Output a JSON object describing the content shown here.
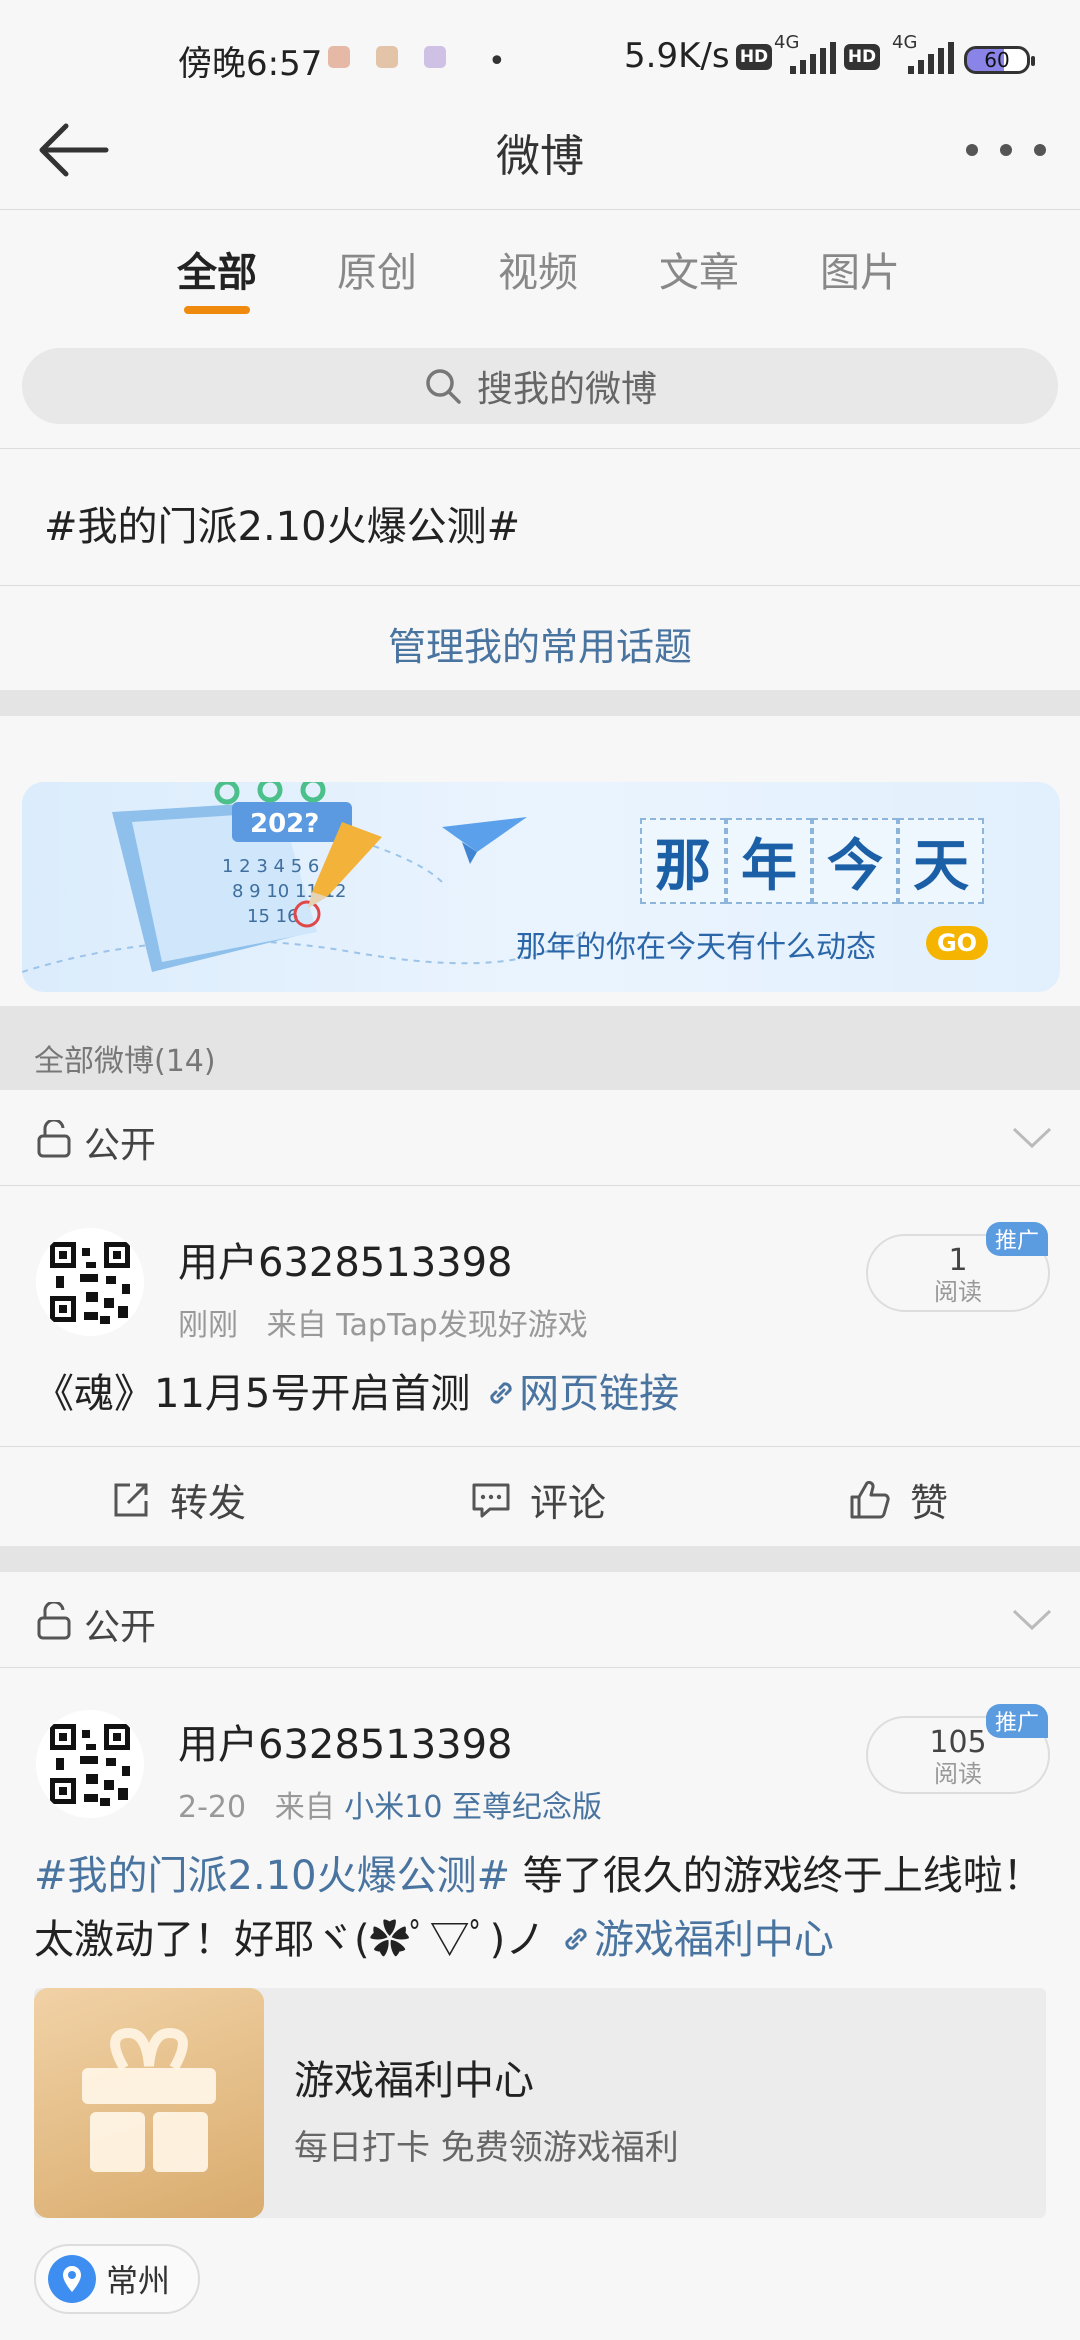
{
  "status": {
    "time": "傍晚6:57",
    "dot": "•",
    "speed": "5.9K/s",
    "hd": "HD",
    "net": "4G",
    "battery": "60"
  },
  "header": {
    "title": "微博"
  },
  "tabs": [
    {
      "label": "全部",
      "active": true
    },
    {
      "label": "原创"
    },
    {
      "label": "视频"
    },
    {
      "label": "文章"
    },
    {
      "label": "图片"
    }
  ],
  "search": {
    "placeholder": "搜我的微博"
  },
  "topic": {
    "text": "#我的门派2.10火爆公测#"
  },
  "manage": {
    "label": "管理我的常用话题"
  },
  "banner": {
    "year": "202?",
    "title_chars": [
      "那",
      "年",
      "今",
      "天"
    ],
    "subtitle": "那年的你在今天有什么动态",
    "go": "GO",
    "icon": "calendar-pencil-illustration"
  },
  "list": {
    "count_label": "全部微博(14)"
  },
  "posts": [
    {
      "visibility": "公开",
      "user": "用户6328513398",
      "time": "刚刚",
      "source_prefix": "来自",
      "source": "TapTap发现好游戏",
      "read_count": "1",
      "read_label": "阅读",
      "promo": "推广",
      "text": "《魂》11月5号开启首测",
      "link": "网页链接",
      "actions": {
        "repost": "转发",
        "comment": "评论",
        "like": "赞"
      }
    },
    {
      "visibility": "公开",
      "user": "用户6328513398",
      "time": "2-20",
      "source_prefix": "来自",
      "source": "小米10 至尊纪念版",
      "read_count": "105",
      "read_label": "阅读",
      "promo": "推广",
      "hashtag": "#我的门派2.10火爆公测#",
      "text_line1": " 等了很久的游戏终于上线啦！",
      "text_line2": "太激动了！好耶ヾ(✿ﾟ▽ﾟ)ノ",
      "link": "游戏福利中心",
      "card_title": "游戏福利中心",
      "card_sub": "每日打卡 免费领游戏福利",
      "location": "常州"
    }
  ],
  "colors": {
    "accent": "#f08a0e",
    "link": "#4a74a0",
    "promo": "#5b9be0"
  }
}
